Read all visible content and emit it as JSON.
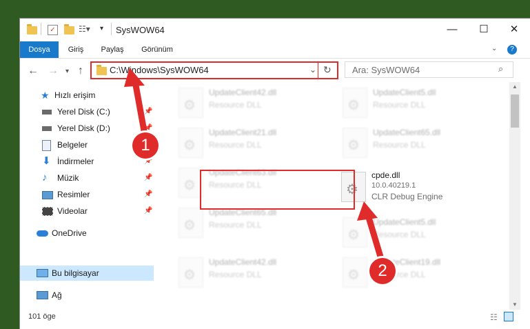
{
  "window": {
    "title": "SysWOW64",
    "minimize_icon": "minimize-icon",
    "maximize_icon": "maximize-icon",
    "close_icon": "close-icon"
  },
  "ribbon": {
    "tabs": [
      {
        "label": "Dosya",
        "active": true
      },
      {
        "label": "Giriş"
      },
      {
        "label": "Paylaş"
      },
      {
        "label": "Görünüm"
      }
    ]
  },
  "address": {
    "path": "C:\\Windows\\SysWOW64"
  },
  "search": {
    "placeholder": "Ara: SysWOW64"
  },
  "sidebar": {
    "items": [
      {
        "label": "Hızlı erişim",
        "icon": "star-icon"
      },
      {
        "label": "Yerel Disk (C:)",
        "icon": "drive-icon",
        "pinned": true
      },
      {
        "label": "Yerel Disk (D:)",
        "icon": "drive-icon",
        "pinned": true
      },
      {
        "label": "Belgeler",
        "icon": "documents-icon",
        "pinned": true
      },
      {
        "label": "İndirmeler",
        "icon": "download-icon",
        "pinned": true
      },
      {
        "label": "Müzik",
        "icon": "music-icon",
        "pinned": true
      },
      {
        "label": "Resimler",
        "icon": "pictures-icon",
        "pinned": true
      },
      {
        "label": "Videolar",
        "icon": "videos-icon",
        "pinned": true
      },
      {
        "label": "OneDrive",
        "icon": "cloud-icon"
      },
      {
        "label": "Bu bilgisayar",
        "icon": "computer-icon",
        "selected": true
      },
      {
        "label": "Ağ",
        "icon": "network-icon"
      }
    ]
  },
  "files": [
    {
      "name": "UpdateClient42.dll",
      "desc": "Resource DLL"
    },
    {
      "name": "UpdateClient5.dll",
      "desc": "Resource DLL"
    },
    {
      "name": "UpdateClient21.dll",
      "desc": "Resource DLL"
    },
    {
      "name": "UpdateClient65.dll",
      "desc": "Resource DLL"
    },
    {
      "name": "UpdateClient63.dll",
      "desc": "Resource DLL"
    },
    {
      "name": "cpde.dll",
      "version": "10.0.40219.1",
      "desc": "CLR Debug Engine"
    },
    {
      "name": "UpdateClient65.dll",
      "desc": "Resource DLL"
    },
    {
      "name": "UpdateClient5.dll",
      "desc": "Resource DLL"
    },
    {
      "name": "UpdateClient42.dll",
      "desc": "Resource DLL"
    },
    {
      "name": "UpdateClient19.dll",
      "desc": "Resource DLL"
    }
  ],
  "status": {
    "count": "101 öge"
  },
  "annotations": {
    "step1": "1",
    "step2": "2"
  },
  "colors": {
    "accent": "#1979ca",
    "highlight": "#e02b2b",
    "selection": "#cce8ff"
  }
}
